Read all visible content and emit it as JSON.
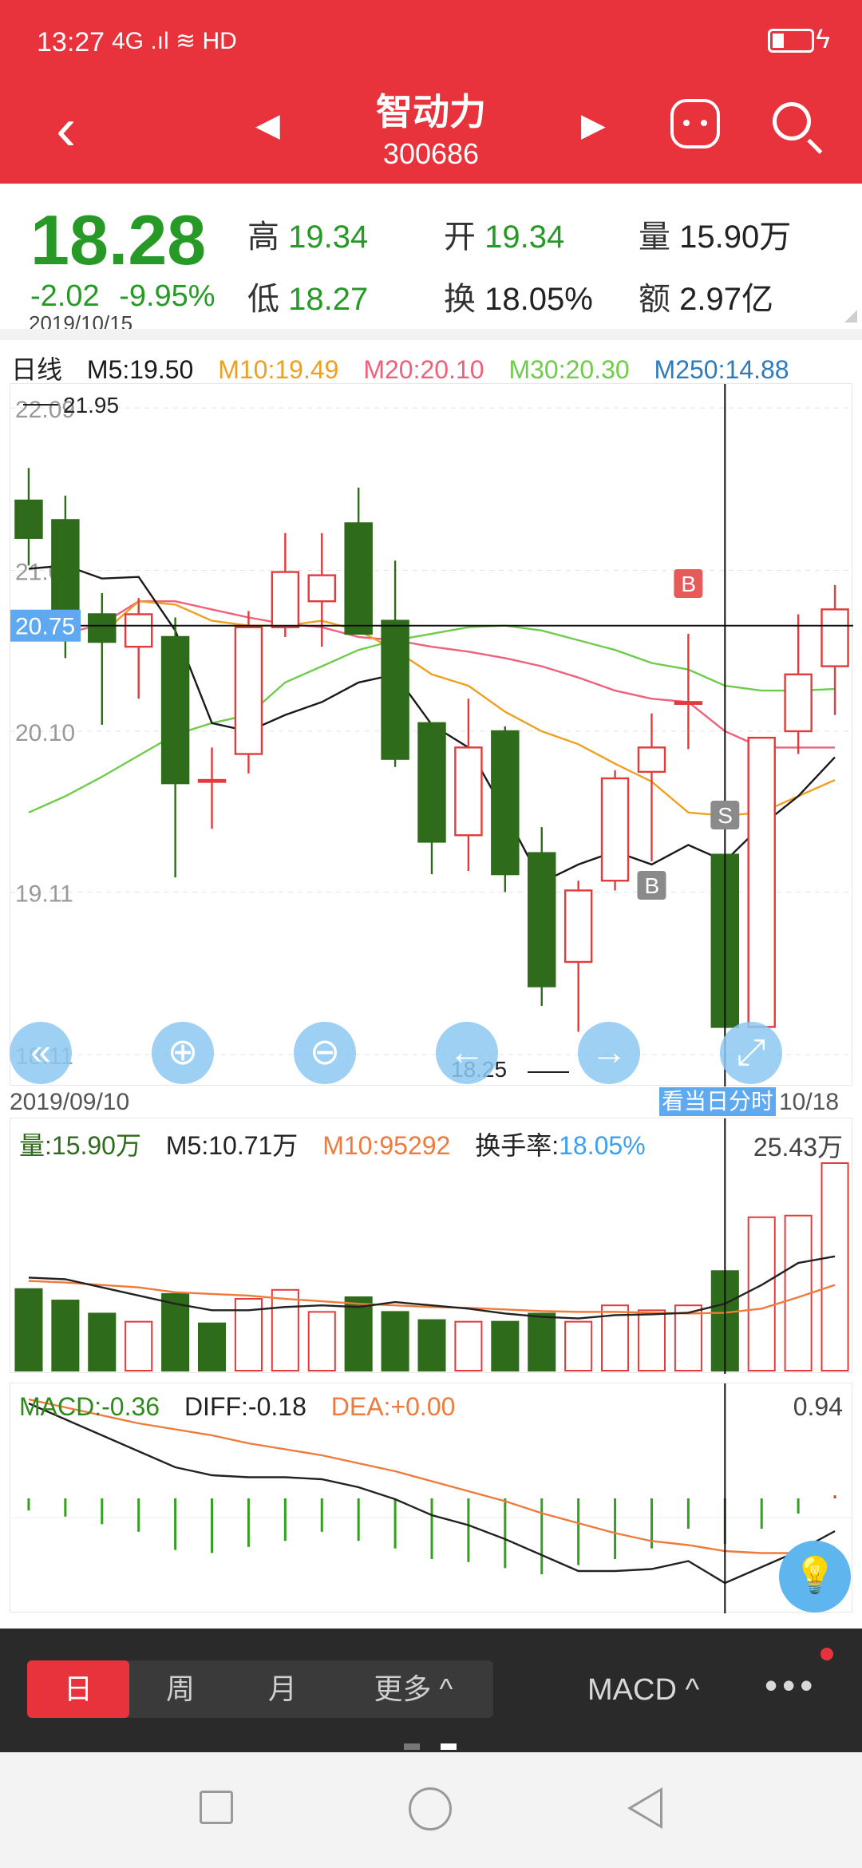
{
  "status": {
    "time": "13:27",
    "network": "4G .ıl ≋ HD",
    "battery_icon": "battery-icon",
    "charging_icon": "bolt-icon"
  },
  "nav": {
    "title": "智动力",
    "code": "300686",
    "back": "back-arrow-icon",
    "prev": "prev-stock-icon",
    "next": "next-stock-icon",
    "robot": "robot-icon",
    "search": "search-icon"
  },
  "quote": {
    "price": "18.28",
    "change": "-2.02",
    "change_pct": "-9.95%",
    "date": "2019/10/15",
    "high_label": "高",
    "high": "19.34",
    "open_label": "开",
    "open": "19.34",
    "vol_label": "量",
    "vol": "15.90万",
    "low_label": "低",
    "low": "18.27",
    "turnover_label": "换",
    "turnover": "18.05%",
    "amount_label": "额",
    "amount": "2.97亿"
  },
  "ma": {
    "period": "日线",
    "m5": "M5:19.50",
    "m10": "M10:19.49",
    "m20": "M20:20.10",
    "m30": "M30:20.30",
    "m250": "M250:14.88"
  },
  "colors": {
    "red": "#e23b3b",
    "green": "#2e6b1a",
    "ma5": "#1a1a1a",
    "ma10": "#f0a020",
    "ma20": "#f0607a",
    "ma30": "#6fcb4a",
    "ma250": "#2c7bc0",
    "accent": "#e8323c"
  },
  "axis": {
    "ticks": [
      "22.09",
      "21.09",
      "20.10",
      "19.11",
      "18.11"
    ],
    "crosshair_price": "20.75",
    "max_label": "21.95",
    "min_label": "18.25",
    "start_date": "2019/09/10",
    "end_date": "10/18",
    "fenshi_button": "看当日分时"
  },
  "markers": [
    "B",
    "S",
    "B"
  ],
  "volume": {
    "label": "量:15.90万",
    "m5": "M5:10.71万",
    "m10": "M10:95292",
    "turnover_label": "换手率:",
    "turnover": "18.05%",
    "max": "25.43万"
  },
  "macd": {
    "macd": "MACD:-0.36",
    "diff": "DIFF:-0.18",
    "dea": "DEA:+0.00",
    "max": "0.94"
  },
  "tabs": {
    "day": "日",
    "week": "周",
    "month": "月",
    "more": "更多 ^",
    "indicator": "MACD ^",
    "overflow": "•••"
  },
  "chart_data": {
    "type": "candlestick",
    "period": "daily",
    "ylim": [
      18.11,
      22.09
    ],
    "candles": [
      {
        "o": 21.52,
        "c": 21.29,
        "h": 21.72,
        "l": 21.12
      },
      {
        "o": 21.4,
        "c": 20.8,
        "h": 21.55,
        "l": 20.55
      },
      {
        "o": 20.82,
        "c": 20.65,
        "h": 20.95,
        "l": 20.14
      },
      {
        "o": 20.62,
        "c": 20.82,
        "h": 20.92,
        "l": 20.3
      },
      {
        "o": 20.68,
        "c": 19.78,
        "h": 20.8,
        "l": 19.2
      },
      {
        "o": 19.8,
        "c": 19.8,
        "h": 20.0,
        "l": 19.5
      },
      {
        "o": 19.96,
        "c": 20.74,
        "h": 20.84,
        "l": 19.84
      },
      {
        "o": 20.74,
        "c": 21.08,
        "h": 21.32,
        "l": 20.68
      },
      {
        "o": 20.9,
        "c": 21.06,
        "h": 21.32,
        "l": 20.62
      },
      {
        "o": 21.38,
        "c": 20.7,
        "h": 21.6,
        "l": 20.7
      },
      {
        "o": 20.78,
        "c": 19.93,
        "h": 21.15,
        "l": 19.88
      },
      {
        "o": 20.15,
        "c": 19.42,
        "h": 20.15,
        "l": 19.22
      },
      {
        "o": 19.46,
        "c": 20.0,
        "h": 20.3,
        "l": 19.24
      },
      {
        "o": 20.1,
        "c": 19.22,
        "h": 20.13,
        "l": 19.11
      },
      {
        "o": 19.35,
        "c": 18.53,
        "h": 19.51,
        "l": 18.41
      },
      {
        "o": 18.68,
        "c": 19.12,
        "h": 19.18,
        "l": 18.25
      },
      {
        "o": 19.18,
        "c": 19.81,
        "h": 19.86,
        "l": 19.12
      },
      {
        "o": 19.85,
        "c": 20.0,
        "h": 20.21,
        "l": 19.3
      },
      {
        "o": 20.28,
        "c": 20.28,
        "h": 20.7,
        "l": 19.99
      },
      {
        "o": 19.34,
        "c": 18.28,
        "h": 19.34,
        "l": 18.27
      },
      {
        "o": 18.28,
        "c": 20.06,
        "h": 20.06,
        "l": 18.28
      },
      {
        "o": 20.1,
        "c": 20.45,
        "h": 20.82,
        "l": 19.96
      },
      {
        "o": 20.5,
        "c": 20.85,
        "h": 21.0,
        "l": 20.2
      }
    ],
    "ma5": [
      21.1,
      21.12,
      21.04,
      21.05,
      20.72,
      20.15,
      20.1,
      20.2,
      20.28,
      20.4,
      20.45,
      20.14,
      20.0,
      19.6,
      19.17,
      19.28,
      19.36,
      19.28,
      19.4,
      19.3,
      19.52,
      19.7,
      19.94
    ],
    "ma10": [
      null,
      null,
      20.7,
      20.9,
      20.88,
      20.78,
      20.75,
      20.75,
      20.78,
      20.72,
      20.6,
      20.45,
      20.38,
      20.22,
      20.1,
      20.02,
      19.9,
      19.79,
      19.6,
      19.58,
      19.6,
      19.7,
      19.8
    ],
    "ma20": [
      null,
      20.7,
      20.76,
      20.9,
      20.9,
      20.85,
      20.8,
      20.76,
      20.74,
      20.68,
      20.66,
      20.62,
      20.59,
      20.55,
      20.5,
      20.43,
      20.35,
      20.3,
      20.28,
      20.1,
      20.0,
      20.0,
      20.0
    ],
    "ma30": [
      19.6,
      19.7,
      19.82,
      19.95,
      20.08,
      20.15,
      20.2,
      20.4,
      20.5,
      20.6,
      20.66,
      20.7,
      20.74,
      20.75,
      20.72,
      20.66,
      20.6,
      20.52,
      20.48,
      20.38,
      20.35,
      20.35,
      20.36
    ],
    "volume": [
      10.0,
      8.6,
      7.0,
      6.0,
      9.4,
      5.8,
      8.8,
      9.9,
      7.2,
      9.0,
      7.2,
      6.2,
      6.0,
      6.0,
      7.0,
      6.0,
      8.0,
      7.4,
      8.0,
      12.2,
      18.8,
      19.0,
      25.43
    ],
    "volume_up": [
      false,
      false,
      false,
      true,
      false,
      false,
      true,
      true,
      true,
      false,
      false,
      false,
      true,
      false,
      false,
      true,
      true,
      true,
      true,
      false,
      true,
      true,
      true
    ],
    "vol_ma5": [
      11.4,
      11.2,
      10.2,
      9.2,
      8.2,
      7.4,
      7.4,
      7.8,
      8.0,
      7.8,
      8.4,
      8.0,
      7.6,
      7.0,
      6.6,
      6.4,
      6.8,
      6.9,
      7.1,
      8.2,
      10.5,
      13.2,
      14.0
    ],
    "vol_ma10": [
      11.0,
      10.8,
      10.5,
      10.2,
      9.6,
      9.4,
      9.2,
      8.8,
      8.5,
      8.2,
      8.0,
      7.8,
      7.7,
      7.5,
      7.3,
      7.2,
      7.2,
      7.1,
      7.0,
      7.1,
      7.6,
      9.0,
      10.5
    ],
    "macd_hist": [
      -0.08,
      -0.12,
      -0.17,
      -0.22,
      -0.34,
      -0.36,
      -0.32,
      -0.28,
      -0.22,
      -0.28,
      -0.33,
      -0.4,
      -0.42,
      -0.46,
      -0.5,
      -0.44,
      -0.4,
      -0.33,
      -0.2,
      -0.3,
      -0.2,
      -0.1,
      0.02
    ],
    "diff": [
      0.94,
      0.86,
      0.78,
      0.7,
      0.62,
      0.58,
      0.57,
      0.57,
      0.56,
      0.52,
      0.46,
      0.38,
      0.33,
      0.26,
      0.18,
      0.1,
      0.1,
      0.11,
      0.15,
      0.04,
      0.12,
      0.2,
      0.3
    ],
    "dea": [
      0.96,
      0.92,
      0.88,
      0.84,
      0.81,
      0.78,
      0.74,
      0.71,
      0.68,
      0.64,
      0.6,
      0.55,
      0.5,
      0.45,
      0.39,
      0.34,
      0.29,
      0.25,
      0.23,
      0.2,
      0.19,
      0.19,
      0.22
    ],
    "markers": [
      {
        "index": 18,
        "label": "B"
      },
      {
        "index": 19,
        "label": "S"
      },
      {
        "index": 17,
        "label": "B"
      }
    ],
    "crosshair_index": 19,
    "crosshair_price": 20.75
  }
}
